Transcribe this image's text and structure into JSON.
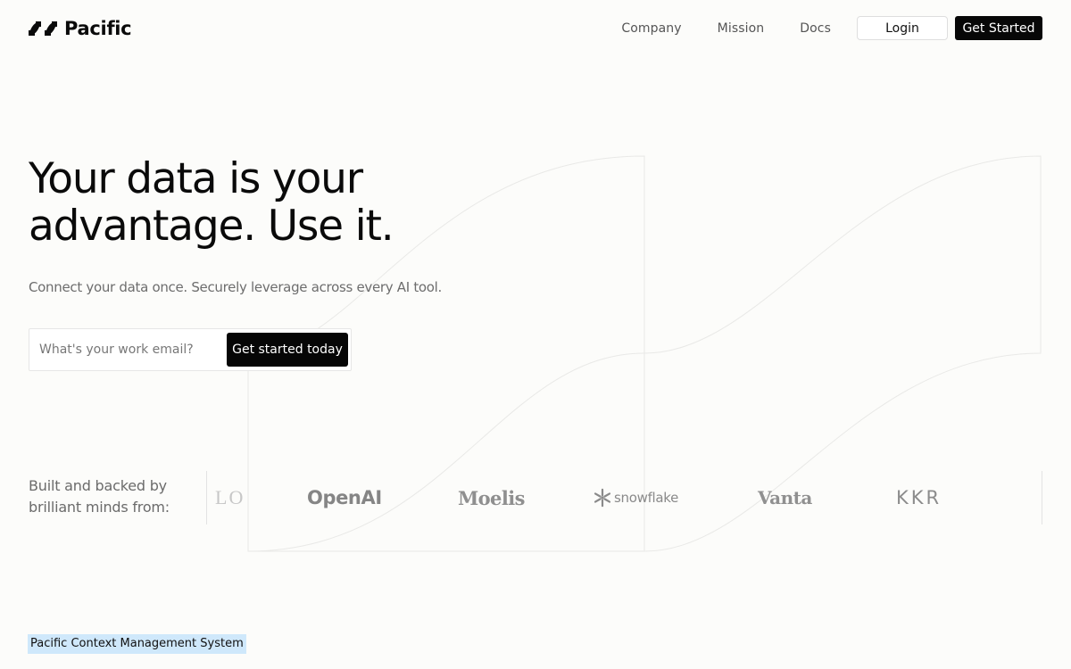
{
  "brand": {
    "name": "Pacific",
    "logo_icon": "pacific-logo-icon"
  },
  "nav": {
    "items": [
      {
        "label": "Company"
      },
      {
        "label": "Mission"
      },
      {
        "label": "Docs"
      }
    ],
    "login_label": "Login",
    "get_started_label": "Get Started"
  },
  "hero": {
    "title_line1": "Your data is your",
    "title_line2": "advantage. Use it.",
    "subtitle": "Connect your data once. Securely leverage across every AI tool.",
    "email_placeholder": "What's your work email?",
    "cta_label": "Get started today"
  },
  "backers": {
    "label_line1": "Built and backed by",
    "label_line2": "brilliant minds from:",
    "logos": [
      {
        "name": "LO"
      },
      {
        "name": "OpenAI"
      },
      {
        "name": "Moelis"
      },
      {
        "name": "snowflake",
        "icon": "snowflake-icon"
      },
      {
        "name": "Vanta"
      },
      {
        "name": "KKR"
      }
    ]
  },
  "section_tag": "Pacific Context Management System",
  "colors": {
    "background": "#fcfcfa",
    "primary_button": "#070707",
    "tag_highlight": "#cfe8fb"
  }
}
